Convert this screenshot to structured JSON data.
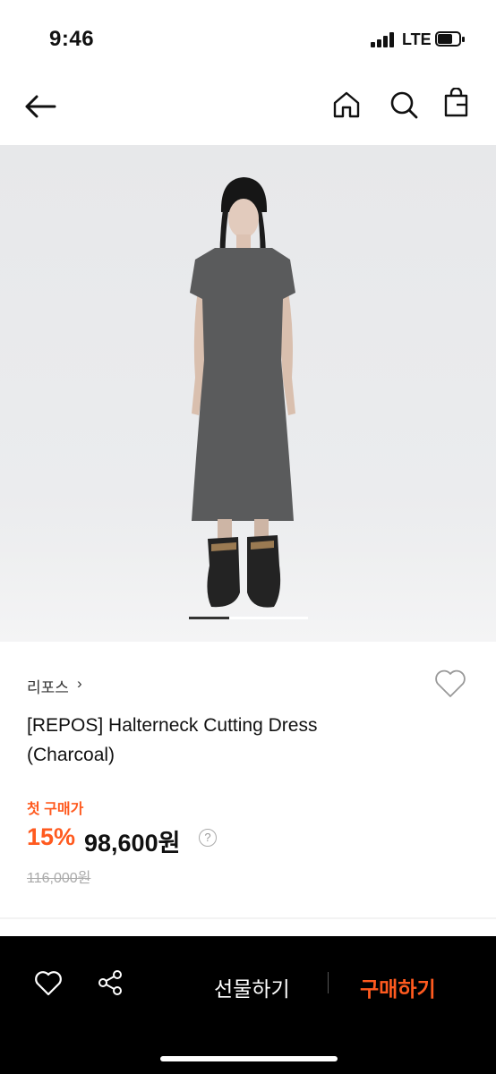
{
  "status_bar": {
    "time": "9:46",
    "network": "LTE",
    "battery_level": 0.6
  },
  "nav": {
    "back_icon": "arrow-left-icon",
    "home_icon": "home-icon",
    "search_icon": "search-icon",
    "bag_icon": "shopping-bag-icon"
  },
  "product_image": {
    "current_slide": 1,
    "slide_count": 3
  },
  "product": {
    "brand": "리포스",
    "brand_chevron": "›",
    "name_line1": "[REPOS] Halterneck Cutting Dress",
    "name_line2": "(Charcoal)",
    "promo_label": "첫 구매가",
    "discount": "15%",
    "price": "98,600원",
    "help": "?",
    "original_price": "116,000원"
  },
  "bottom_bar": {
    "gift_label": "선물하기",
    "buy_label": "구매하기"
  },
  "colors": {
    "accent": "#ff5a1f",
    "bar_bg": "#000000",
    "dress": "#5a5b5c"
  }
}
